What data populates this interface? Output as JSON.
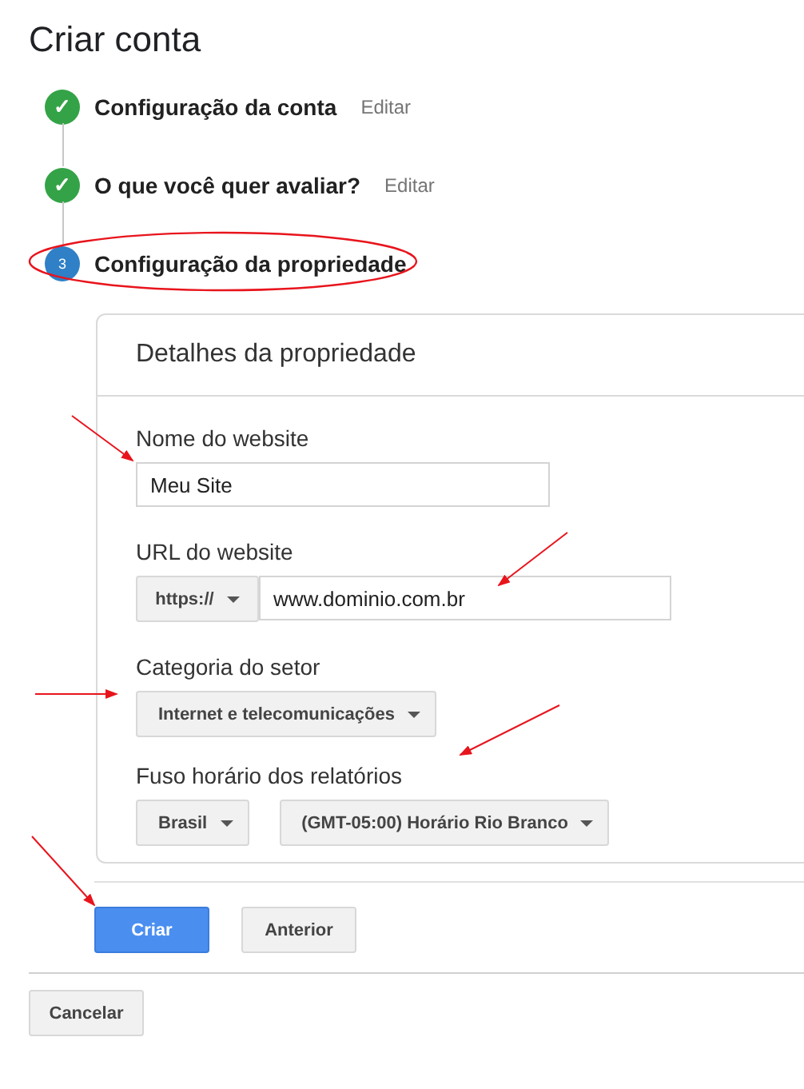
{
  "title": "Criar conta",
  "steps": [
    {
      "number": "✓",
      "label": "Configuração da conta",
      "action": "Editar",
      "kind": "done"
    },
    {
      "number": "✓",
      "label": "O que você quer avaliar?",
      "action": "Editar",
      "kind": "done"
    },
    {
      "number": "3",
      "label": "Configuração da propriedade",
      "kind": "current"
    }
  ],
  "card": {
    "title": "Detalhes da propriedade",
    "website_name": {
      "label": "Nome do website",
      "value": "Meu Site"
    },
    "website_url": {
      "label": "URL do website",
      "protocol": "https://",
      "value": "www.dominio.com.br"
    },
    "industry": {
      "label": "Categoria do setor",
      "value": "Internet e telecomunicações"
    },
    "time_zone": {
      "label": "Fuso horário dos relatórios",
      "country": "Brasil",
      "zone": "(GMT-05:00) Horário Rio Branco"
    }
  },
  "buttons": [
    {
      "label": "Criar",
      "kind": "primary"
    },
    {
      "label": "Anterior",
      "kind": "secondary"
    }
  ],
  "cancel": "Cancelar"
}
